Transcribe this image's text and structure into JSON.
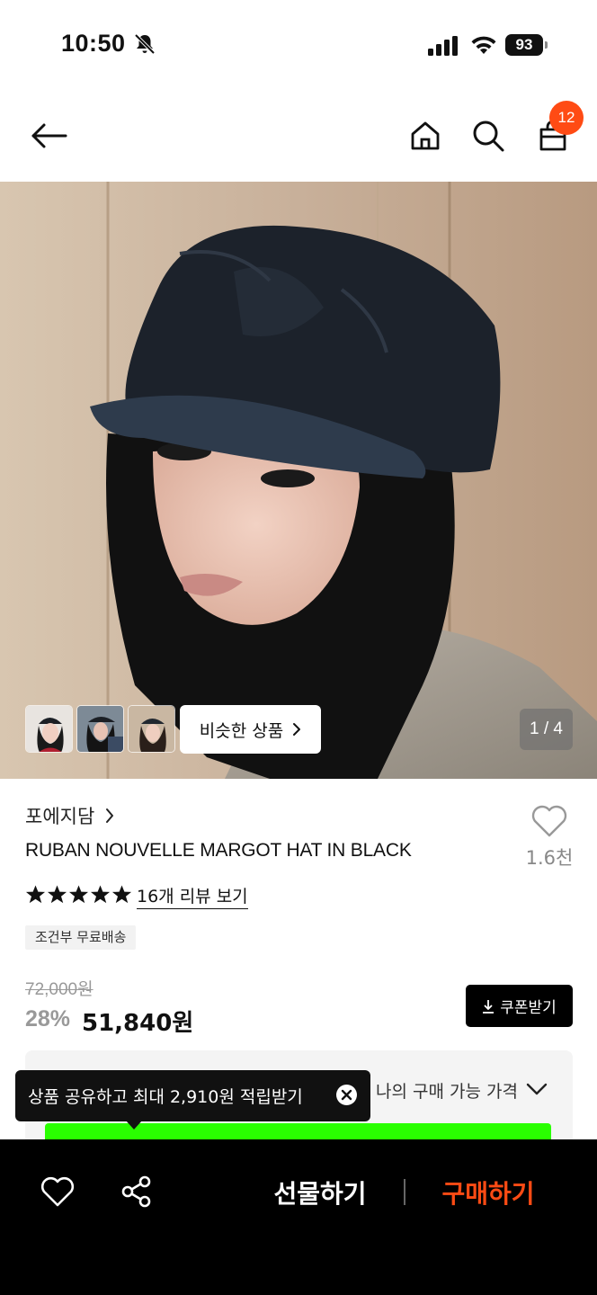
{
  "status_bar": {
    "time": "10:50",
    "battery": "93",
    "icons": [
      "bell-off-icon",
      "signal-icon",
      "wifi-icon",
      "battery-icon"
    ]
  },
  "header": {
    "icons": [
      "back-arrow-icon",
      "home-icon",
      "search-icon",
      "shopping-bag-icon"
    ],
    "cart_count": "12"
  },
  "gallery": {
    "similar_products_label": "비슷한 상품",
    "page_indicator": "1 / 4",
    "thumbnail_count": 3
  },
  "product": {
    "brand": "포에지담",
    "name": "RUBAN NOUVELLE MARGOT HAT IN BLACK",
    "like_count": "1.6천",
    "rating_stars": 5,
    "review_link": "16개 리뷰 보기",
    "shipping_badge": "조건부 무료배송",
    "original_price": "72,000원",
    "discount": "28%",
    "sale_price": "51,840원",
    "coupon_label": "쿠폰받기"
  },
  "my_price": {
    "label": "나의 구매 가능 가격"
  },
  "tooltip": {
    "text": "상품 공유하고 최대 2,910원 적립받기"
  },
  "bottom_bar": {
    "gift_label": "선물하기",
    "buy_label": "구매하기"
  },
  "colors": {
    "accent": "#ff4b14",
    "bar_background": "#000000",
    "green_bar": "#2aff00"
  }
}
